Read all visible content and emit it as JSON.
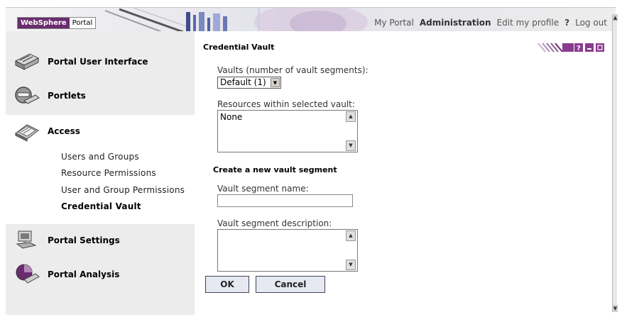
{
  "banner": {
    "logo_brand": "WebSphere",
    "logo_product": "Portal",
    "nav": [
      "My Portal",
      "Administration",
      "Edit my profile",
      "?",
      "Log out"
    ]
  },
  "leftnav": {
    "sections": [
      {
        "label": "Portal User Interface",
        "icon": "portal-ui-icon"
      },
      {
        "label": "Portlets",
        "icon": "portlets-icon"
      },
      {
        "label": "Access",
        "icon": "access-icon"
      },
      {
        "label": "Portal Settings",
        "icon": "portal-settings-icon"
      },
      {
        "label": "Portal Analysis",
        "icon": "portal-analysis-icon"
      }
    ],
    "access_items": [
      "Users and Groups",
      "Resource Permissions",
      "User and Group Permissions",
      "Credential Vault"
    ],
    "current_item": "Credential Vault"
  },
  "main": {
    "title": "Credential Vault",
    "vaults_label": "Vaults (number of vault segments):",
    "vaults_selected": "Default (1)",
    "resources_label": "Resources within selected vault:",
    "resources_value": "None",
    "create_heading": "Create a new vault segment",
    "segment_name_label": "Vault segment name:",
    "segment_name_value": "",
    "segment_desc_label": "Vault segment description:",
    "segment_desc_value": "",
    "ok_label": "OK",
    "cancel_label": "Cancel"
  },
  "colors": {
    "brand_purple": "#6b2c6f",
    "nav_bg": "#ececec",
    "portlet_ctl": "#8b3a8f"
  }
}
